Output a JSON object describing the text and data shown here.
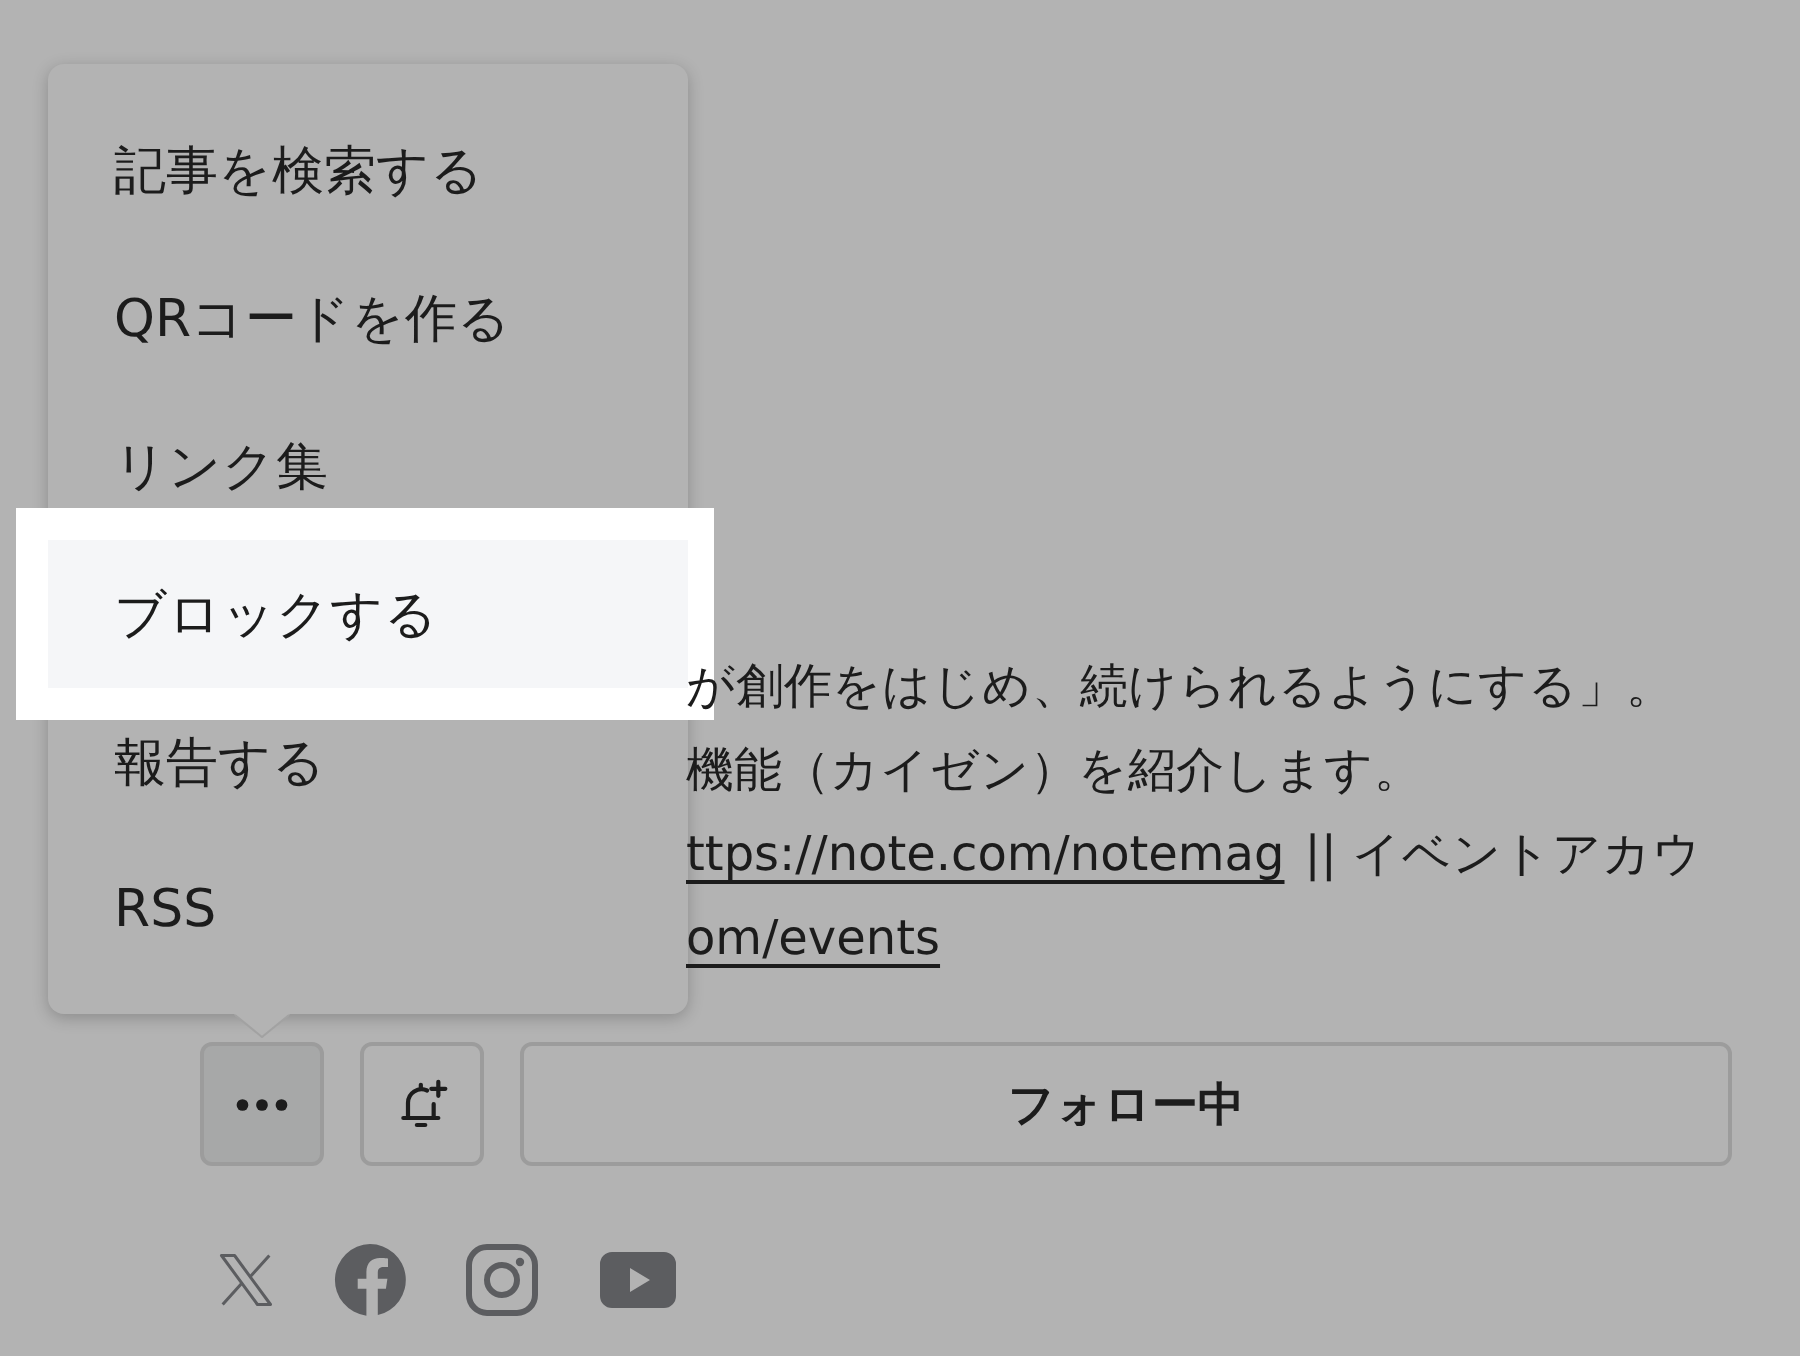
{
  "menu": {
    "items": [
      {
        "label": "記事を検索する",
        "highlighted": false
      },
      {
        "label": "QRコードを作る",
        "highlighted": false
      },
      {
        "label": "リンク集",
        "highlighted": false
      },
      {
        "label": "ブロックする",
        "highlighted": true
      },
      {
        "label": "報告する",
        "highlighted": false
      },
      {
        "label": "RSS",
        "highlighted": false
      }
    ]
  },
  "description": {
    "lines": [
      {
        "segments": [
          {
            "kind": "text",
            "text": "が創作をはじめ、続けられるようにする」。"
          }
        ]
      },
      {
        "segments": [
          {
            "kind": "text",
            "text": "機能（カイゼン）を紹介します。"
          }
        ]
      },
      {
        "segments": [
          {
            "kind": "link",
            "text": "ttps://note.com/notemag"
          },
          {
            "kind": "text",
            "text": "|| イベントアカウ"
          }
        ]
      },
      {
        "segments": [
          {
            "kind": "link",
            "text": "om/events"
          }
        ]
      }
    ]
  },
  "actions": [
    {
      "kind": "more",
      "pressed": true
    },
    {
      "kind": "notify",
      "pressed": false
    },
    {
      "kind": "follow",
      "label": "フォロー中",
      "pressed": false
    }
  ],
  "social_links": [
    {
      "kind": "x"
    },
    {
      "kind": "facebook"
    },
    {
      "kind": "instagram"
    },
    {
      "kind": "youtube"
    }
  ]
}
